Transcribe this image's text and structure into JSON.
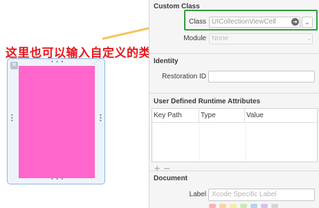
{
  "annotation": {
    "text": "这里也可以输入自定义的类，可以在里面修改cell属性"
  },
  "inspector": {
    "custom_class": {
      "title": "Custom Class",
      "class_label": "Class",
      "class_value": "UICollectionViewCell",
      "module_label": "Module",
      "module_value": "None"
    },
    "identity": {
      "title": "Identity",
      "restoration_id_label": "Restoration ID",
      "restoration_id_value": ""
    },
    "runtime_attributes": {
      "title": "User Defined Runtime Attributes",
      "columns": [
        "Key Path",
        "Type",
        "Value"
      ],
      "add_symbol": "+",
      "remove_symbol": "−"
    },
    "document": {
      "title": "Document",
      "label_label": "Label",
      "label_placeholder": "Xcode Specific Label"
    }
  },
  "colors": {
    "highlight_box": "#2e9e3a",
    "annotation_text": "#e8161b",
    "arrow": "#f4c55a",
    "cell_background": "#ff66cc",
    "swatches": [
      "#f9b3b3",
      "#f8d3a8",
      "#f6ecab",
      "#c9eab7",
      "#b6d3f2",
      "#d8c0ee",
      "#d6d6d6"
    ]
  }
}
